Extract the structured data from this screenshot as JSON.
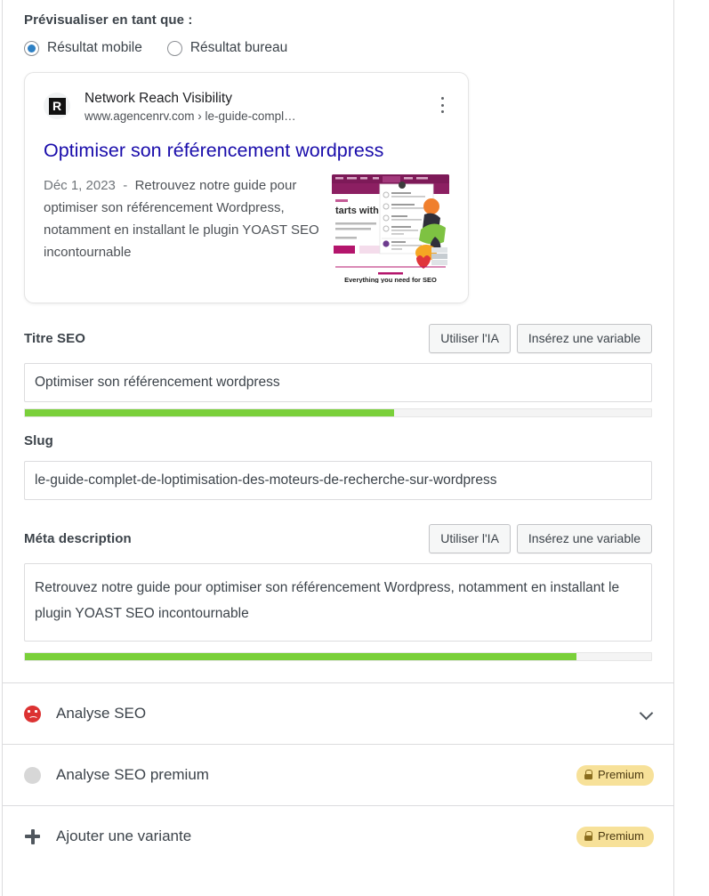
{
  "preview": {
    "section_label": "Prévisualiser en tant que :",
    "options": [
      {
        "label": "Résultat mobile",
        "selected": true,
        "icon": "radio-selected-icon"
      },
      {
        "label": "Résultat bureau",
        "selected": false,
        "icon": "radio-unselected-icon"
      }
    ],
    "snippet": {
      "favicon_letter": "R",
      "site_name": "Network Reach Visibility",
      "url": "www.agencenrv.com › le-guide-compl…",
      "title": "Optimiser son référencement wordpress",
      "date": "Déc 1, 2023",
      "separator": "-",
      "description": "Retrouvez notre guide pour optimiser son référencement Wordpress, notamment en installant le plugin YOAST SEO incontournable",
      "thumbnail_caption": "Everything you need for SEO",
      "thumbnail_headline": "tarts with",
      "kebab_icon": "more-options-icon"
    }
  },
  "fields": {
    "seo_title": {
      "label": "Titre SEO",
      "value": "Optimiser son référencement wordpress",
      "placeholder": "Titre SEO",
      "ai_button": "Utiliser l'IA",
      "variable_button": "Insérez une variable",
      "progress_percent": 59,
      "progress_color": "#7ad03a"
    },
    "slug": {
      "label": "Slug",
      "value": "le-guide-complet-de-loptimisation-des-moteurs-de-recherche-sur-wordpress",
      "placeholder": "Slug"
    },
    "meta_description": {
      "label": "Méta description",
      "value": "Retrouvez notre guide pour optimiser son référencement Wordpress, notamment en installant le plugin YOAST SEO incontournable",
      "placeholder": "Méta description",
      "ai_button": "Utiliser l'IA",
      "variable_button": "Insérez une variable",
      "progress_percent": 88,
      "progress_color": "#7ad03a"
    }
  },
  "rows": [
    {
      "label": "Analyse SEO",
      "icon": "sad-face-icon",
      "trailing": "chevron-down-icon",
      "badge": null
    },
    {
      "label": "Analyse SEO premium",
      "icon": "grey-circle-icon",
      "trailing": "premium-badge",
      "badge": "Premium"
    },
    {
      "label": "Ajouter une variante",
      "icon": "plus-icon",
      "trailing": "premium-badge",
      "badge": "Premium"
    }
  ]
}
